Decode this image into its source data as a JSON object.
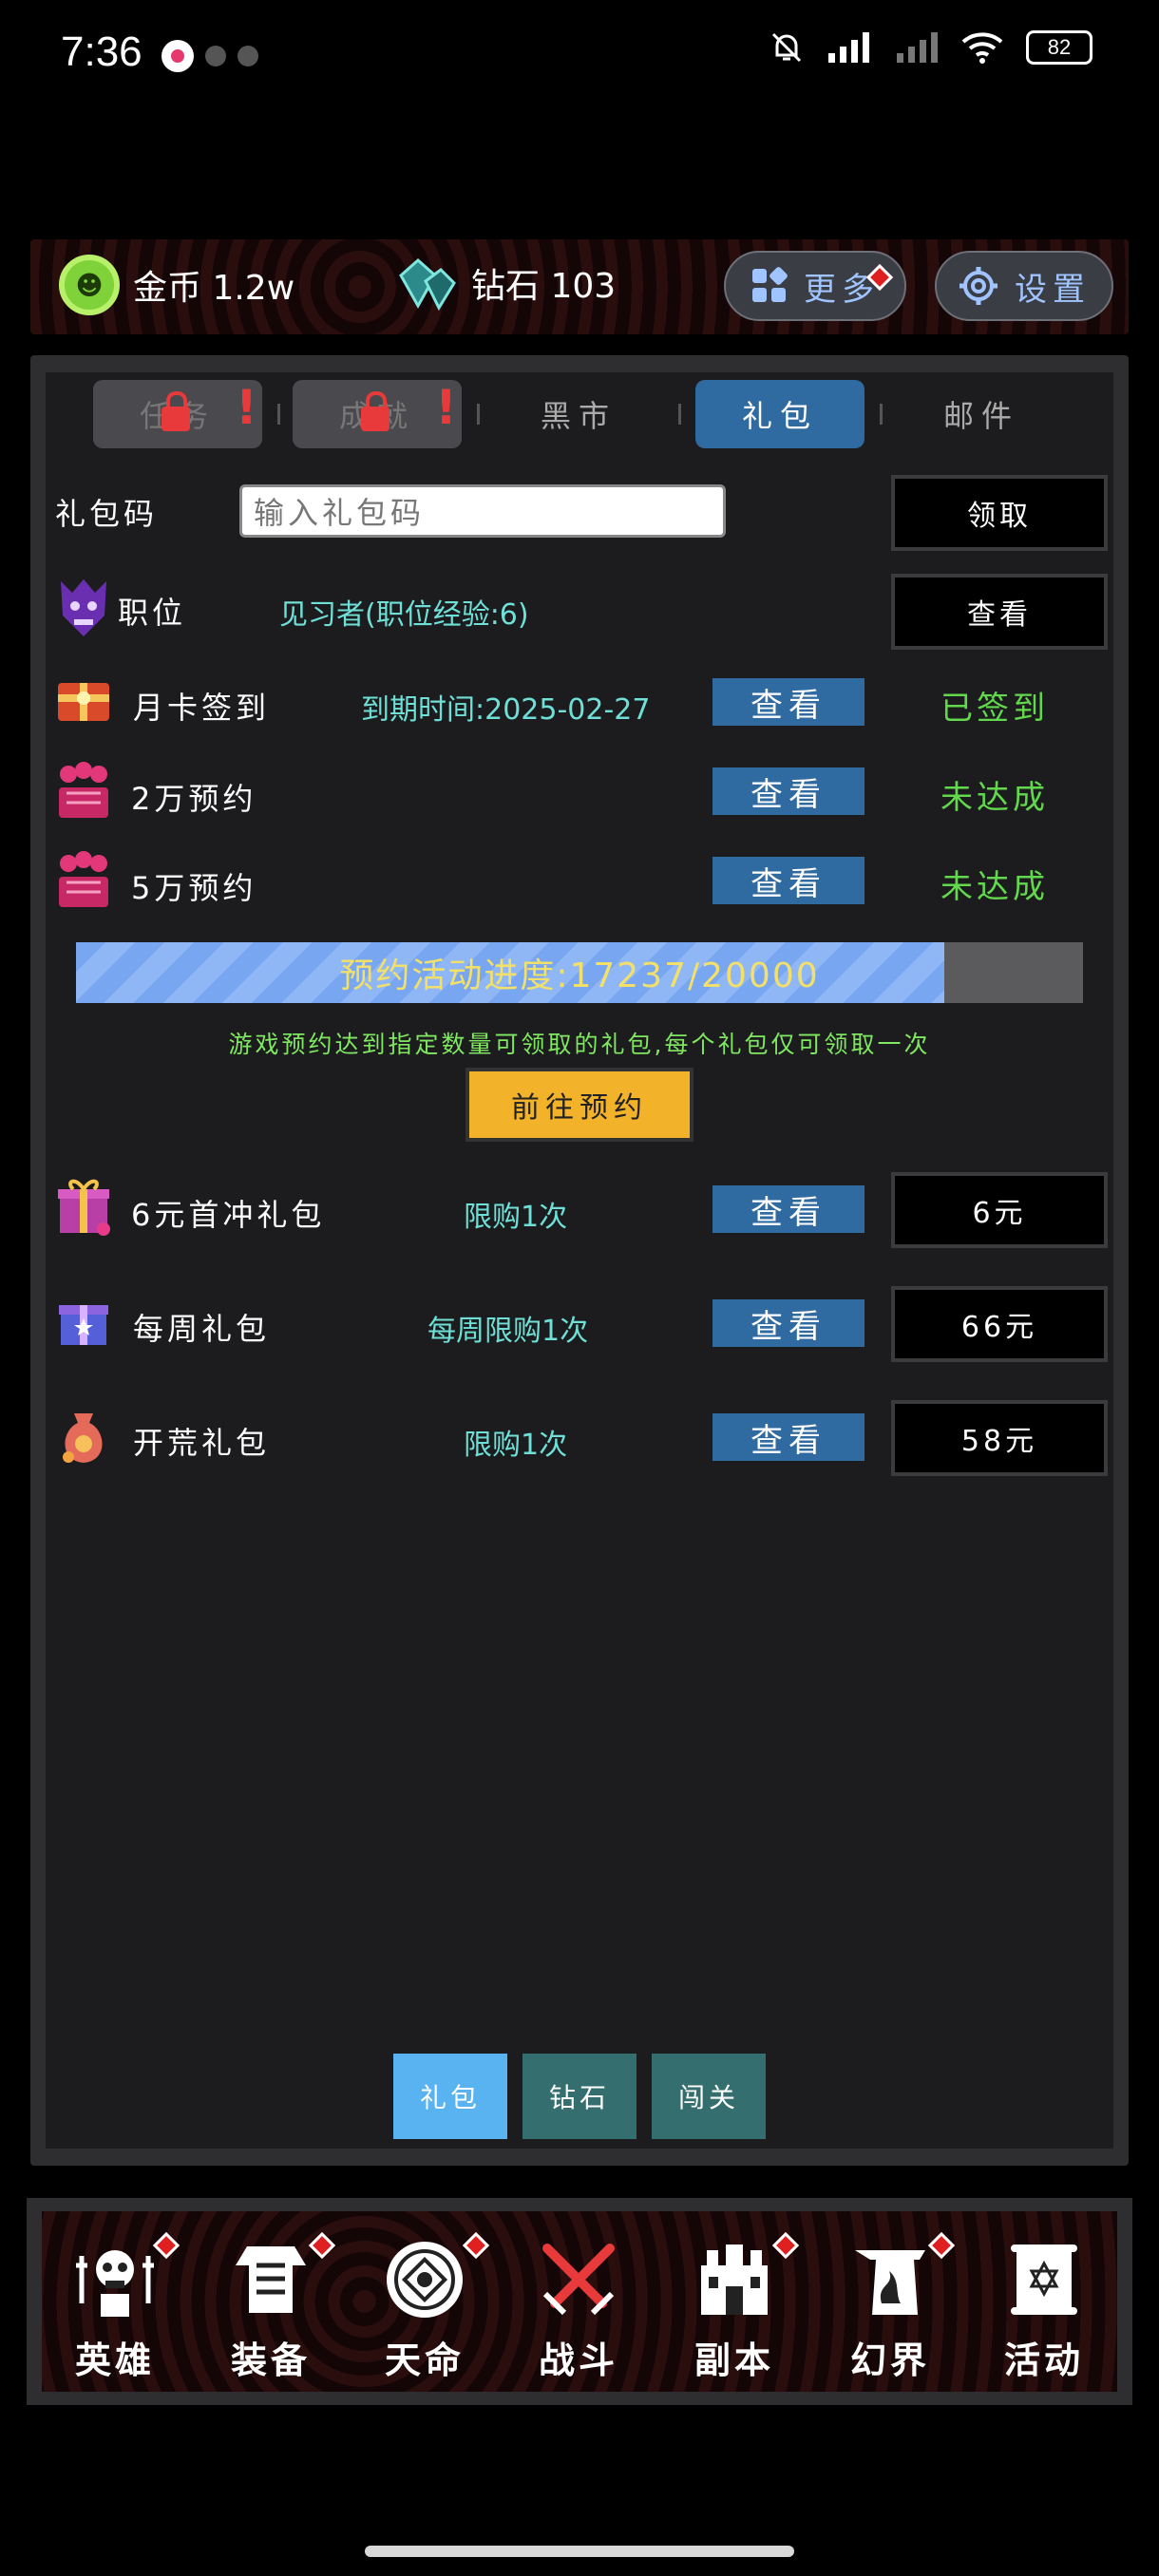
{
  "status_bar": {
    "time": "7:36",
    "battery": "82"
  },
  "resources": {
    "coin_label": "金币 1.2w",
    "gem_label": "钻石 103",
    "more_label": "更多",
    "settings_label": "设置"
  },
  "tabs": [
    {
      "label": "任务",
      "locked": true
    },
    {
      "label": "成就",
      "locked": true
    },
    {
      "label": "黑市",
      "locked": false
    },
    {
      "label": "礼包",
      "locked": false,
      "active": true
    },
    {
      "label": "邮件",
      "locked": false
    }
  ],
  "gift_code": {
    "label": "礼包码",
    "placeholder": "输入礼包码",
    "button": "领取"
  },
  "job": {
    "label": "职位",
    "value": "见习者(职位经验:6)",
    "button": "查看"
  },
  "rows": [
    {
      "name": "月卡签到",
      "info": "到期时间:2025-02-27",
      "view": "查看",
      "status": "已签到"
    },
    {
      "name": "2万预约",
      "view": "查看",
      "status": "未达成"
    },
    {
      "name": "5万预约",
      "view": "查看",
      "status": "未达成"
    }
  ],
  "progress": {
    "text": "预约活动进度:17237/20000",
    "current": 17237,
    "total": 20000
  },
  "note": "游戏预约达到指定数量可领取的礼包,每个礼包仅可领取一次",
  "goto_button": "前往预约",
  "packs": [
    {
      "name": "6元首冲礼包",
      "limit": "限购1次",
      "view": "查看",
      "price": "6元"
    },
    {
      "name": "每周礼包",
      "limit": "每周限购1次",
      "view": "查看",
      "price": "66元"
    },
    {
      "name": "开荒礼包",
      "limit": "限购1次",
      "view": "查看",
      "price": "58元"
    }
  ],
  "sub_tabs": [
    {
      "label": "礼包",
      "active": true
    },
    {
      "label": "钻石",
      "active": false
    },
    {
      "label": "闯关",
      "active": false
    }
  ],
  "bottom_nav": [
    {
      "label": "英雄",
      "icon": "hero-icon"
    },
    {
      "label": "装备",
      "icon": "armor-icon"
    },
    {
      "label": "天命",
      "icon": "destiny-icon"
    },
    {
      "label": "战斗",
      "icon": "crossed-swords-icon"
    },
    {
      "label": "副本",
      "icon": "dungeon-icon"
    },
    {
      "label": "幻界",
      "icon": "phantom-realm-icon"
    },
    {
      "label": "活动",
      "icon": "scroll-icon"
    }
  ],
  "colors": {
    "accent_blue": "#2f6aa0",
    "status_green": "#62d84c",
    "info_cyan": "#6fe0d7",
    "progress_text": "#f3e06a",
    "goto_button": "#f2b32a",
    "alert_red": "#e83a3a"
  }
}
